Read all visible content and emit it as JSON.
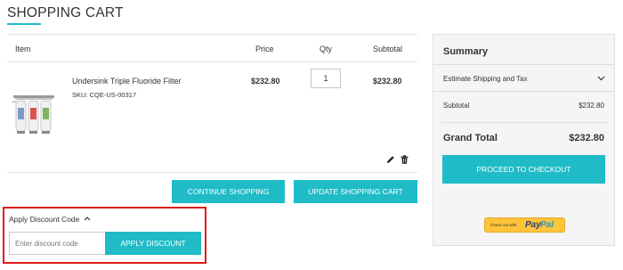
{
  "page": {
    "title": "SHOPPING CART"
  },
  "colors": {
    "accent": "#1fbcc7",
    "highlight_border": "#e21a1a",
    "paypal_yellow": "#ffc439",
    "paypal_dark_blue": "#253b80",
    "paypal_light_blue": "#179bd7"
  },
  "cart": {
    "headers": {
      "item": "Item",
      "price": "Price",
      "qty": "Qty",
      "subtotal": "Subtotal"
    },
    "items": [
      {
        "name": "Undersink Triple Fluoride Filter",
        "sku": "SKU: CQE-US-00317",
        "price": "$232.80",
        "qty": "1",
        "subtotal": "$232.80",
        "image_icon": "water-filter-product-image",
        "actions": [
          "pencil-icon",
          "trash-icon"
        ]
      }
    ],
    "buttons": {
      "continue": "CONTINUE SHOPPING",
      "update": "UPDATE SHOPPING CART"
    }
  },
  "discount": {
    "toggle_label": "Apply Discount Code",
    "toggle_icon": "chevron-up-icon",
    "input_placeholder": "Enter discount code",
    "input_value": "",
    "apply_label": "APPLY DISCOUNT"
  },
  "summary": {
    "title": "Summary",
    "shipping_label": "Estimate Shipping and Tax",
    "shipping_icon": "chevron-down-icon",
    "subtotal_label": "Subtotal",
    "subtotal_value": "$232.80",
    "grand_total_label": "Grand Total",
    "grand_total_value": "$232.80",
    "checkout_label": "PROCEED TO CHECKOUT",
    "paypal": {
      "prefix": "Check out with",
      "brand_pay": "Pay",
      "brand_pal": "Pal"
    }
  }
}
